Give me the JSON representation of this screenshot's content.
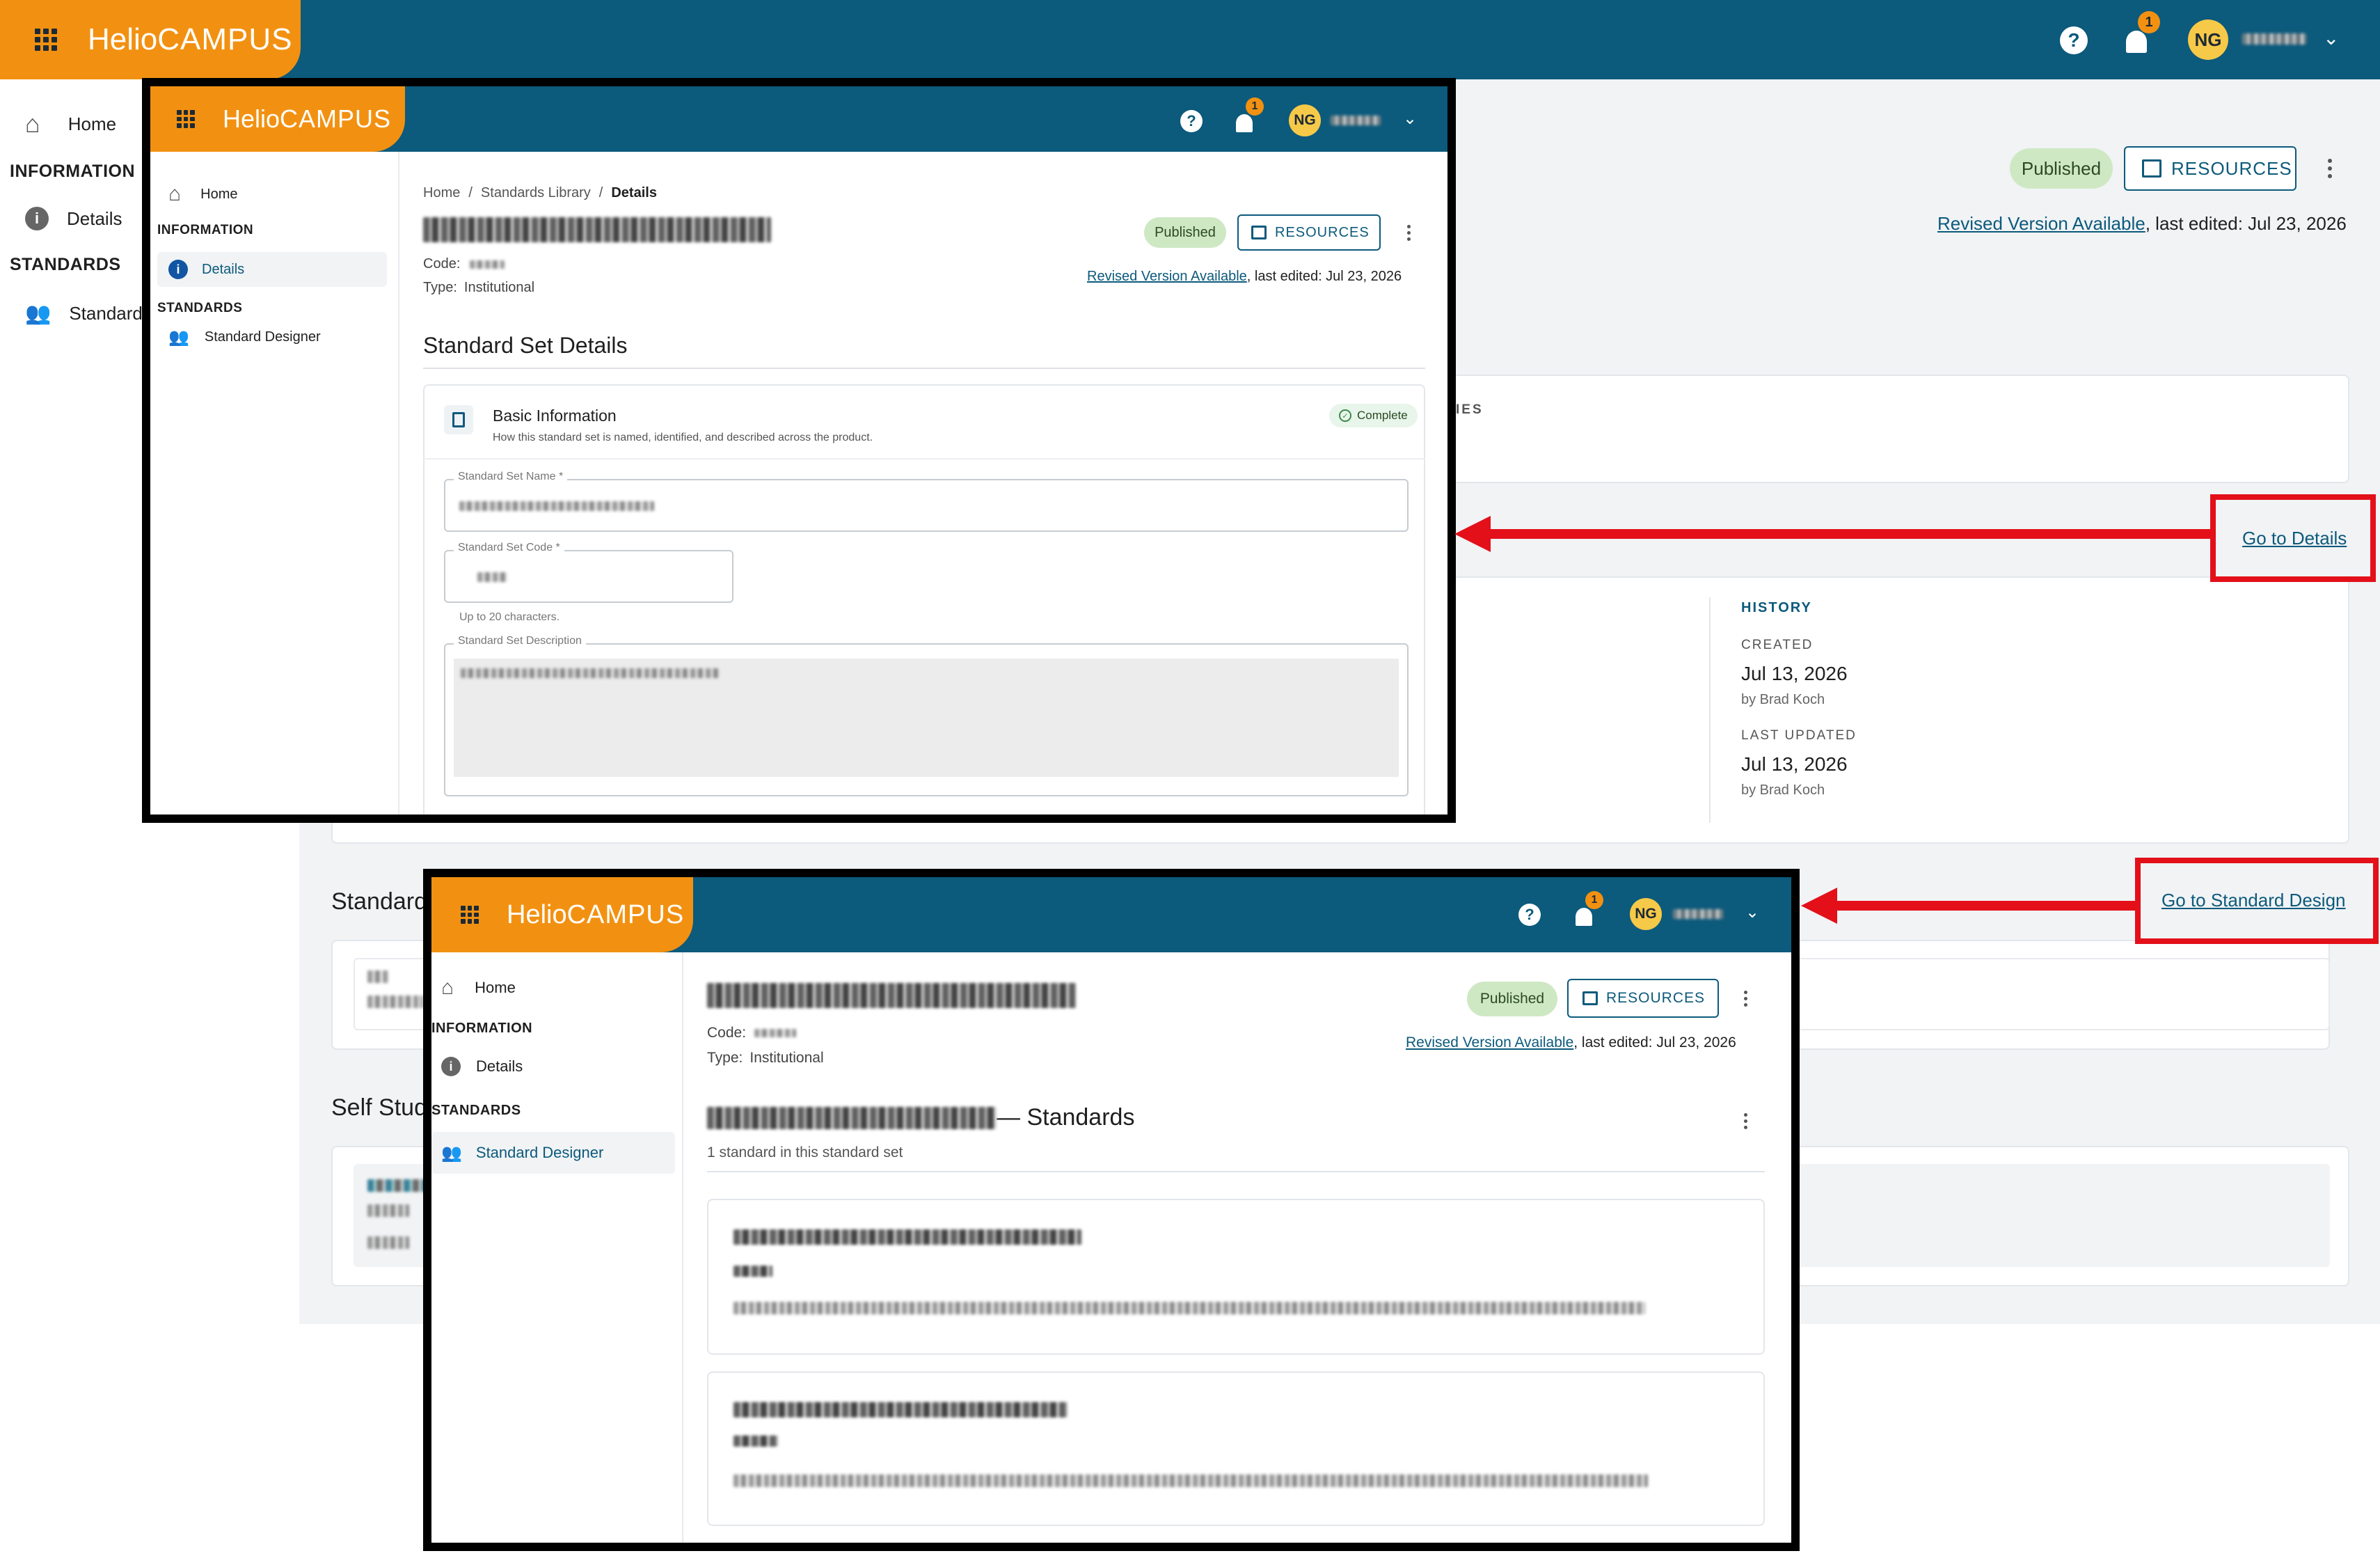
{
  "brand": {
    "logo_helio": "Helio",
    "logo_campus": "CAMPUS"
  },
  "topbar": {
    "notification_count": "1",
    "avatar_initials": "NG"
  },
  "nav": {
    "home": "Home",
    "information": "INFORMATION",
    "details": "Details",
    "standards": "STANDARDS",
    "standard_designer": "Standard Designer",
    "standard_truncated": "Standard"
  },
  "page": {
    "status": "Published",
    "resources": "RESOURCES",
    "revised_link": "Revised Version Available",
    "last_edited": ", last edited: Jul 23, 2026",
    "code_label": "Code:",
    "type_label": "Type:",
    "type_value": "Institutional"
  },
  "breadcrumb": {
    "home": "Home",
    "sep": "/",
    "library": "Standards Library",
    "current": "Details"
  },
  "details": {
    "section_title": "Standard Set Details",
    "basic_info_title": "Basic Information",
    "basic_info_desc": "How this standard set is named, identified, and described across the product.",
    "complete": "Complete",
    "name_label": "Standard Set Name *",
    "code_label": "Standard Set Code *",
    "code_hint": "Up to 20 characters.",
    "desc_label": "Standard Set Description"
  },
  "background": {
    "partial_ies": "IES",
    "history": "HISTORY",
    "created": "CREATED",
    "created_date": "Jul 13, 2026",
    "created_by": "by Brad Koch",
    "last_updated": "LAST UPDATED",
    "updated_date": "Jul 13, 2026",
    "updated_by": "by Brad Koch",
    "standards_heading": "Standard",
    "self_study_heading": "Self Stud"
  },
  "designer": {
    "title_suffix": " — Standards",
    "count": "1 standard in this standard set"
  },
  "annotations": {
    "go_to_details": "Go to Details",
    "go_to_design": "Go to Standard Design"
  }
}
